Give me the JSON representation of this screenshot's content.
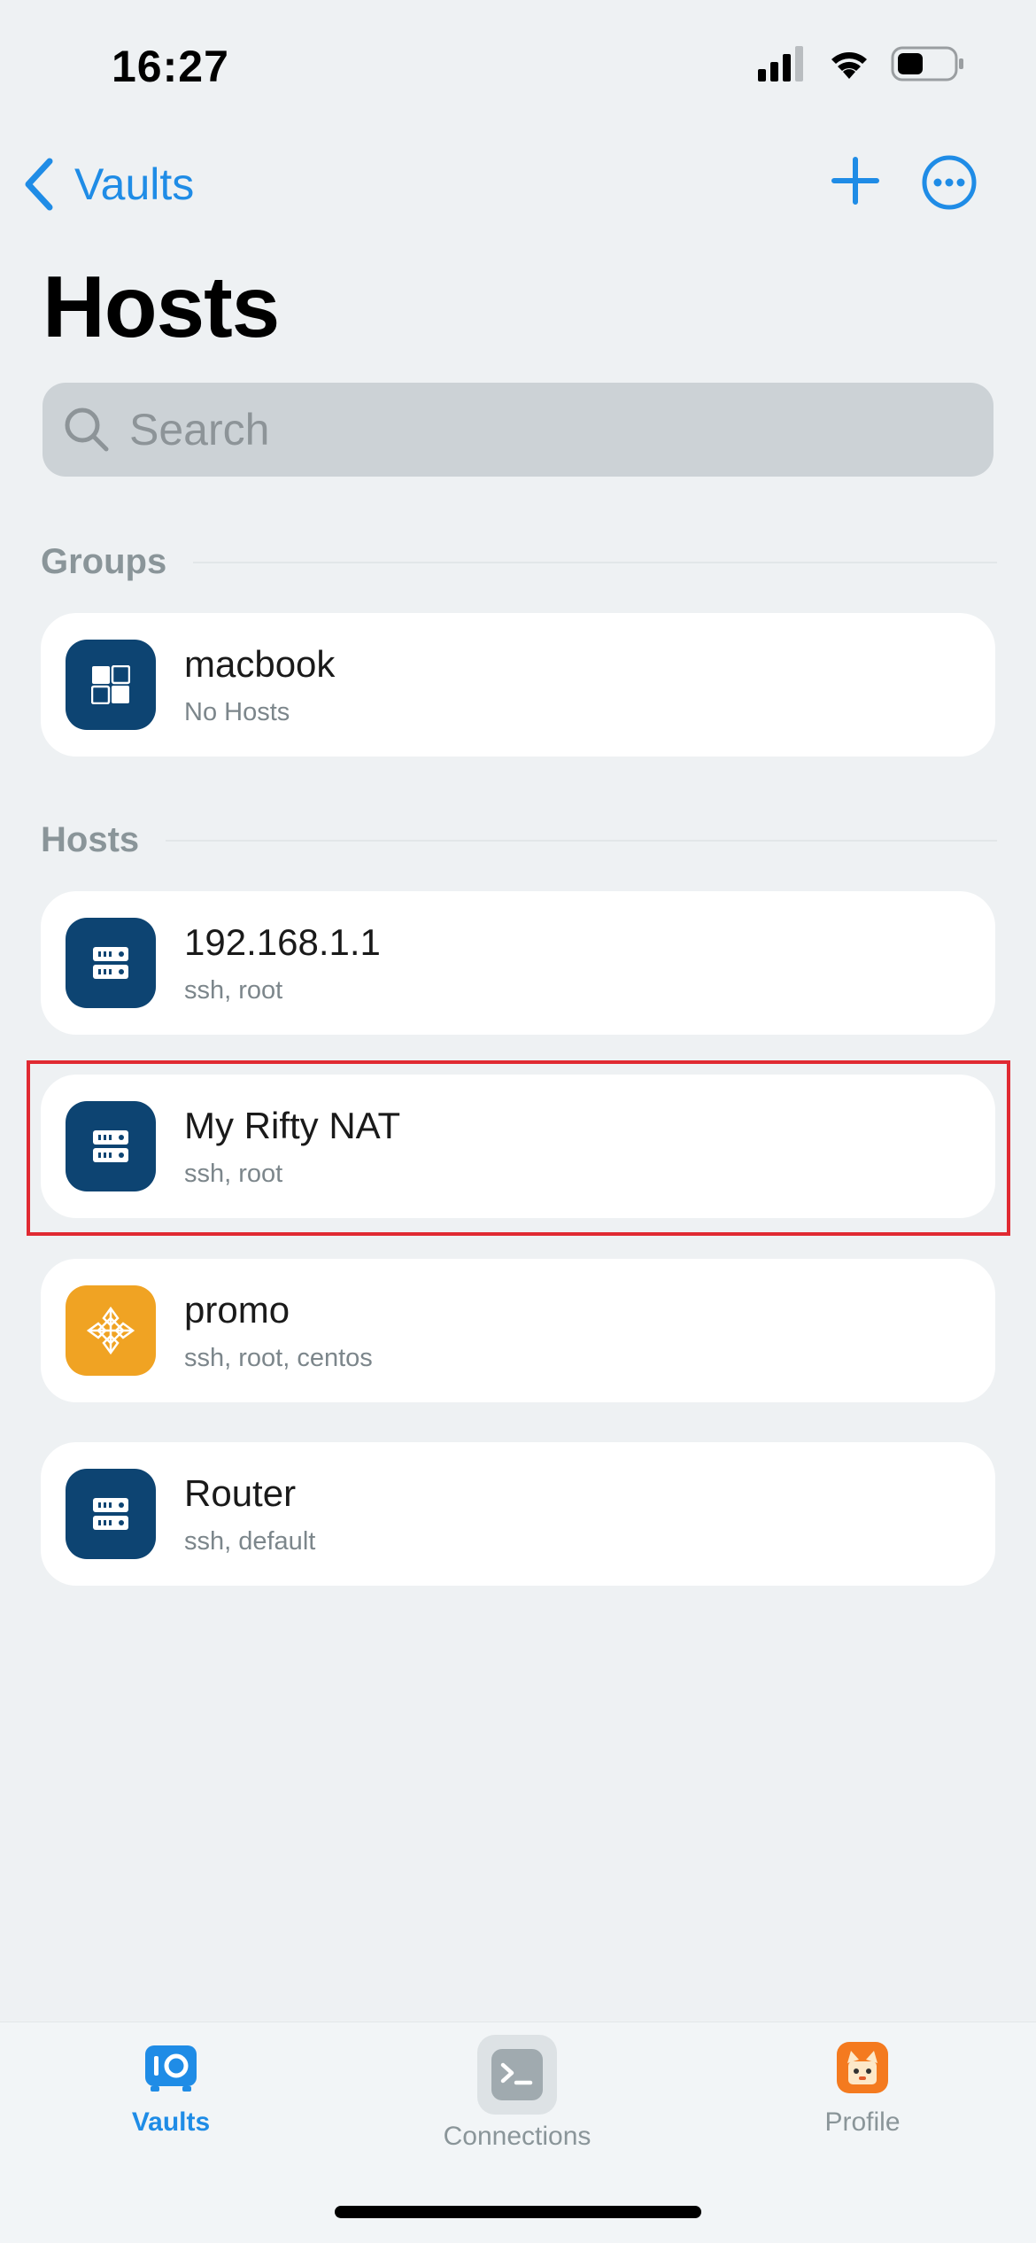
{
  "status": {
    "time": "16:27"
  },
  "nav": {
    "back_label": "Vaults"
  },
  "page": {
    "title": "Hosts"
  },
  "search": {
    "placeholder": "Search"
  },
  "groups": {
    "header": "Groups",
    "items": [
      {
        "title": "macbook",
        "subtitle": "No Hosts",
        "icon": "group-icon"
      }
    ]
  },
  "hosts": {
    "header": "Hosts",
    "items": [
      {
        "title": "192.168.1.1",
        "subtitle": "ssh, root",
        "icon": "server-icon"
      },
      {
        "title": "My Rifty NAT",
        "subtitle": "ssh, root",
        "icon": "server-icon"
      },
      {
        "title": "promo",
        "subtitle": "ssh, root, centos",
        "icon": "centos-icon"
      },
      {
        "title": "Router",
        "subtitle": "ssh, default",
        "icon": "server-icon"
      }
    ]
  },
  "tabs": [
    {
      "label": "Vaults",
      "active": true
    },
    {
      "label": "Connections",
      "active": false
    },
    {
      "label": "Profile",
      "active": false
    }
  ],
  "colors": {
    "accent": "#1f8ce6",
    "icon_bg": "#0d4472",
    "promo_bg": "#f0a323",
    "highlight": "#e02a32"
  }
}
